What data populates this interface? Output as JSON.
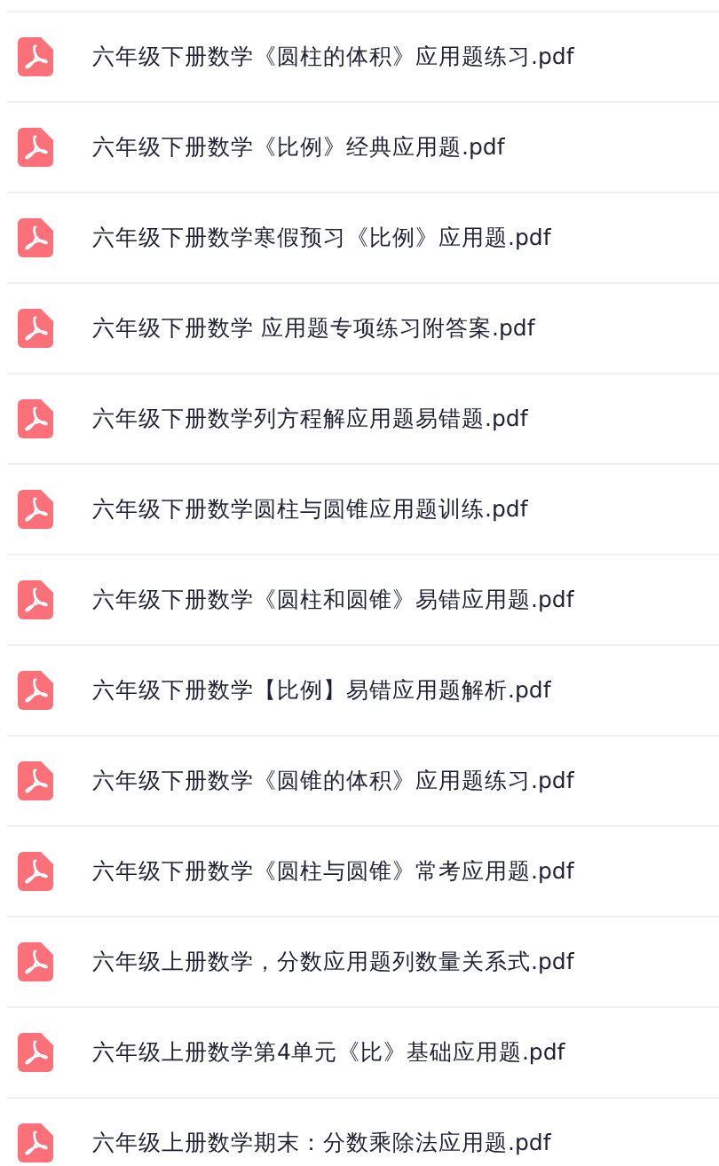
{
  "files": [
    {
      "name": "六年级下册数学《圆柱的体积》应用题练习.pdf"
    },
    {
      "name": "六年级下册数学《比例》经典应用题.pdf"
    },
    {
      "name": "六年级下册数学寒假预习《比例》应用题.pdf"
    },
    {
      "name": "六年级下册数学 应用题专项练习附答案.pdf"
    },
    {
      "name": "六年级下册数学列方程解应用题易错题.pdf"
    },
    {
      "name": "六年级下册数学圆柱与圆锥应用题训练.pdf"
    },
    {
      "name": "六年级下册数学《圆柱和圆锥》易错应用题.pdf"
    },
    {
      "name": "六年级下册数学【比例】易错应用题解析.pdf"
    },
    {
      "name": "六年级下册数学《圆锥的体积》应用题练习.pdf"
    },
    {
      "name": "六年级下册数学《圆柱与圆锥》常考应用题.pdf"
    },
    {
      "name": "六年级上册数学，分数应用题列数量关系式.pdf"
    },
    {
      "name": "六年级上册数学第4单元《比》基础应用题.pdf"
    },
    {
      "name": "六年级上册数学期末：分数乘除法应用题.pdf"
    }
  ]
}
